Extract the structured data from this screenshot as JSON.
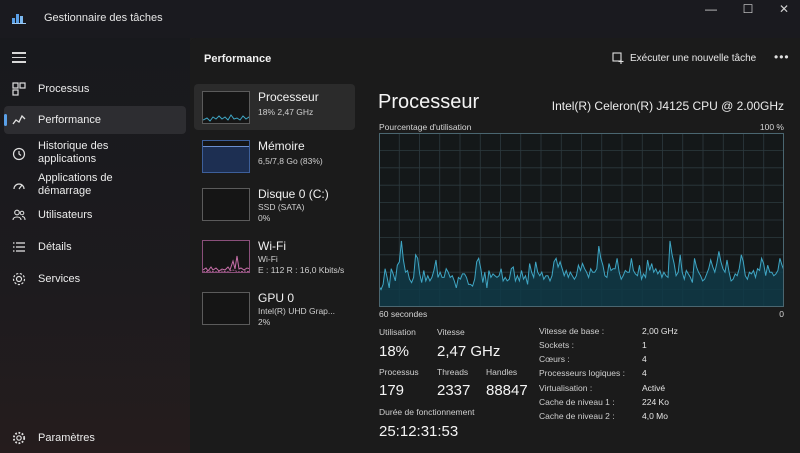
{
  "app": {
    "title": "Gestionnaire des tâches"
  },
  "window_controls": {
    "minimize": "—",
    "maximize": "☐",
    "close": "✕"
  },
  "sidebar": {
    "items": [
      {
        "label": "Processus",
        "icon": "processes-icon"
      },
      {
        "label": "Performance",
        "icon": "performance-icon",
        "active": true
      },
      {
        "label": "Historique des applications",
        "icon": "history-icon"
      },
      {
        "label": "Applications de démarrage",
        "icon": "startup-icon"
      },
      {
        "label": "Utilisateurs",
        "icon": "users-icon"
      },
      {
        "label": "Détails",
        "icon": "details-icon"
      },
      {
        "label": "Services",
        "icon": "services-icon"
      }
    ],
    "settings": {
      "label": "Paramètres",
      "icon": "gear-icon"
    }
  },
  "header": {
    "title": "Performance",
    "run_task_label": "Exécuter une nouvelle tâche",
    "more_label": "•••"
  },
  "devices": [
    {
      "name": "Processeur",
      "lines": [
        "18% 2,47 GHz"
      ],
      "active": true
    },
    {
      "name": "Mémoire",
      "lines": [
        "6,5/7,8 Go (83%)"
      ]
    },
    {
      "name": "Disque 0 (C:)",
      "lines": [
        "SSD (SATA)",
        "0%"
      ]
    },
    {
      "name": "Wi-Fi",
      "lines": [
        "Wi-Fi",
        "E : 112 R : 16,0 Kbits/s"
      ]
    },
    {
      "name": "GPU 0",
      "lines": [
        "Intel(R) UHD Grap...",
        "2%"
      ]
    }
  ],
  "detail": {
    "title": "Processeur",
    "model": "Intel(R) Celeron(R) J4125 CPU @ 2.00GHz",
    "graph": {
      "label_top_left": "Pourcentage d'utilisation",
      "label_top_right": "100 %",
      "label_bottom_left": "60 secondes",
      "label_bottom_right": "0"
    },
    "stats": {
      "utilisation_label": "Utilisation",
      "utilisation": "18%",
      "vitesse_label": "Vitesse",
      "vitesse": "2,47 GHz",
      "processus_label": "Processus",
      "processus": "179",
      "threads_label": "Threads",
      "threads": "2337",
      "handles_label": "Handles",
      "handles": "88847",
      "uptime_label": "Durée de fonctionnement",
      "uptime": "25:12:31:53"
    },
    "properties": [
      {
        "key": "Vitesse de base :",
        "value": "2,00 GHz"
      },
      {
        "key": "Sockets :",
        "value": "1"
      },
      {
        "key": "Cœurs :",
        "value": "4"
      },
      {
        "key": "Processeurs logiques :",
        "value": "4"
      },
      {
        "key": "Virtualisation :",
        "value": "Activé"
      },
      {
        "key": "Cache de niveau 1 :",
        "value": "224 Ko"
      },
      {
        "key": "Cache de niveau 2 :",
        "value": "4,0 Mo"
      }
    ]
  },
  "chart_data": {
    "type": "area",
    "y_range": [
      0,
      100
    ],
    "x_range_seconds": [
      60,
      0
    ],
    "grid": true,
    "values": [
      12,
      10,
      13,
      22,
      17,
      11,
      22,
      19,
      15,
      24,
      26,
      38,
      27,
      20,
      21,
      16,
      14,
      17,
      30,
      28,
      19,
      14,
      21,
      15,
      18,
      15,
      17,
      21,
      27,
      17,
      20,
      17,
      17,
      22,
      20,
      17,
      18,
      15,
      11,
      17,
      16,
      19,
      19,
      17,
      13,
      13,
      12,
      16,
      26,
      28,
      22,
      14,
      20,
      11,
      21,
      17,
      19,
      18,
      17,
      18,
      22,
      15,
      17,
      15,
      16,
      22,
      23,
      15,
      18,
      15,
      21,
      16,
      18,
      13,
      25,
      20,
      17,
      26,
      20,
      18,
      20,
      16,
      18,
      18,
      15,
      18,
      26,
      28,
      23,
      26,
      22,
      18,
      21,
      17,
      20,
      18,
      16,
      18,
      24,
      21,
      25,
      22,
      20,
      17,
      22,
      20,
      20,
      22,
      35,
      28,
      24,
      18,
      17,
      25,
      21,
      22,
      22,
      28,
      20,
      16,
      18,
      21,
      20,
      20,
      28,
      21,
      19,
      18,
      24,
      16,
      19,
      17,
      27,
      21,
      25,
      20,
      22,
      19,
      21,
      17,
      20,
      18,
      17,
      38,
      30,
      25,
      18,
      20,
      30,
      20,
      16,
      21,
      19,
      17,
      14,
      28,
      23,
      20,
      18,
      15,
      16,
      19,
      22,
      27,
      23,
      20,
      25,
      32,
      26,
      22,
      20,
      27,
      20,
      15,
      16,
      19,
      18,
      22,
      30,
      26,
      18,
      16,
      20,
      19,
      21,
      17,
      22,
      21,
      28,
      25,
      18,
      24,
      20,
      20,
      18,
      19,
      21,
      28,
      24,
      21
    ]
  },
  "colors": {
    "accent": "#5aa0e8",
    "graph_line": "#3fa6c4",
    "graph_fill": "#0f3a48",
    "graph_grid": "#2c3a3f"
  }
}
